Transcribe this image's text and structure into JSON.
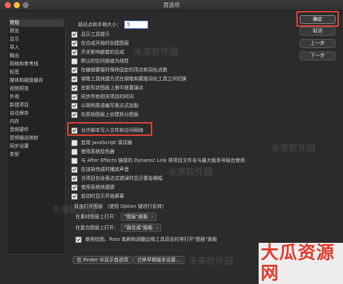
{
  "window": {
    "title": "首选项"
  },
  "sidebar": {
    "items": [
      {
        "label": "常规",
        "selected": true
      },
      {
        "label": "预览"
      },
      {
        "label": "显示"
      },
      {
        "label": "导入"
      },
      {
        "label": "输出"
      },
      {
        "label": "网格和参考线"
      },
      {
        "label": "标签"
      },
      {
        "label": "媒体和磁盘缓存"
      },
      {
        "label": "视频预览"
      },
      {
        "label": "外观"
      },
      {
        "label": "新建项目"
      },
      {
        "label": "自动保存"
      },
      {
        "label": "内存"
      },
      {
        "label": "音频硬件"
      },
      {
        "label": "音频输出映射"
      },
      {
        "label": "同步设置"
      },
      {
        "label": "类型"
      }
    ]
  },
  "settings": {
    "path_label": "路径点和手柄大小：",
    "path_value": "5",
    "checkboxes": [
      {
        "label": "显示工具提示",
        "checked": true
      },
      {
        "label": "在合成开始时创建图层",
        "checked": true
      },
      {
        "label": "开关影响嵌套的合成",
        "checked": true
      },
      {
        "label": "默认的空间插值为线性",
        "checked": false
      },
      {
        "label": "在编辑蒙版时保持固定的顶点和羽化点数",
        "checked": true
      },
      {
        "label": "钢笔工具快捷方式在钢笔和蒙版羽化工具之间切换",
        "checked": true
      },
      {
        "label": "在新形状图层上居中放置锚点",
        "checked": true
      },
      {
        "label": "同步所有相关项目的时间",
        "checked": true
      },
      {
        "label": "以简明英语编写表达式拾取",
        "checked": true
      },
      {
        "label": "在原始图层上创建拆分图层",
        "checked": true
      },
      {
        "label": "允许脚本写入文件和访问网络",
        "checked": true
      },
      {
        "label": "启用 JavaScript 调试器",
        "checked": false
      },
      {
        "label": "使用系统拾色器",
        "checked": false
      },
      {
        "label": "与 After Effects 链接的 Dynamic Link 将项目文件名与最大版本号结合使用",
        "checked": false
      },
      {
        "label": "在渲染完成时播放声音",
        "checked": true
      },
      {
        "label": "当项目包含表达式错误时显示警告横幅",
        "checked": true
      },
      {
        "label": "使用系统快捷键",
        "checked": true
      },
      {
        "label": "启动时显示开始屏幕",
        "checked": true
      }
    ],
    "double_click_header": "双击打开图层 （使用 Option 键进行反转）",
    "footage_label": "在素材图层上打开：",
    "footage_value": "\"图层\"面板",
    "comp_label": "在复合图层上打开：",
    "comp_value": "\"源合成\"面板",
    "last_checkbox": {
      "label": "使用绘图、Roto 笔刷和调整边缘工具双击时将打开\"图层\"面板",
      "checked": true
    },
    "reveal_finder": "在 Finder 中显示首选项",
    "migrate": "迁移早期版本设置..."
  },
  "buttons": {
    "ok": "确定",
    "cancel": "取消",
    "prev": "上一步",
    "next": "下一步"
  },
  "watermark": {
    "text": "未来软件园",
    "url": "www.orsoon.com"
  },
  "brand": {
    "text": "大瓜资源网"
  },
  "colors": {
    "highlight": "#e8443a",
    "brand": "#e23a2e"
  }
}
